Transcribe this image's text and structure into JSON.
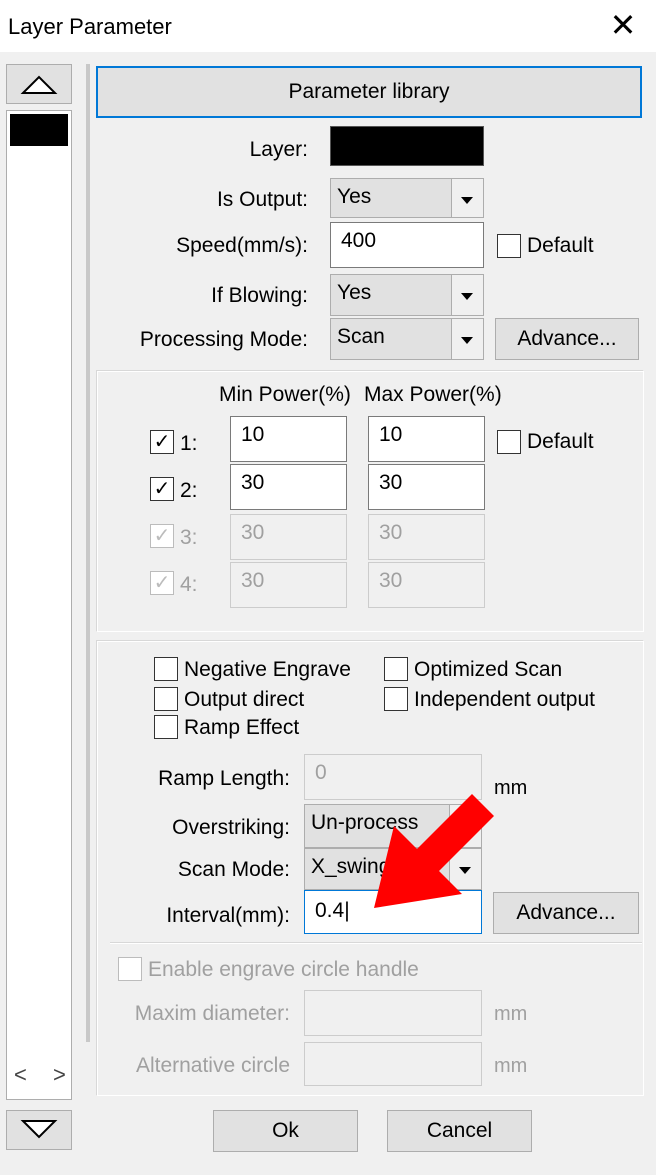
{
  "window": {
    "title": "Layer Parameter",
    "close_glyph": "✕"
  },
  "sidebar": {
    "up_icon": "triangle-up-icon",
    "down_icon": "triangle-down-icon",
    "scroll_arrows": "< >"
  },
  "header": {
    "param_library_label": "Parameter library"
  },
  "layer": {
    "label": "Layer:",
    "color": "#000000"
  },
  "is_output": {
    "label": "Is Output:",
    "value": "Yes"
  },
  "speed": {
    "label": "Speed(mm/s):",
    "value": "400",
    "default_label": "Default",
    "default_checked": false
  },
  "if_blowing": {
    "label": "If Blowing:",
    "value": "Yes"
  },
  "processing_mode": {
    "label": "Processing Mode:",
    "value": "Scan",
    "advance_label": "Advance..."
  },
  "power": {
    "min_header": "Min Power(%)",
    "max_header": "Max Power(%)",
    "default_label": "Default",
    "rows": [
      {
        "label": "1:",
        "checked": true,
        "enabled": true,
        "min": "10",
        "max": "10"
      },
      {
        "label": "2:",
        "checked": true,
        "enabled": true,
        "min": "30",
        "max": "30"
      },
      {
        "label": "3:",
        "checked": true,
        "enabled": false,
        "min": "30",
        "max": "30"
      },
      {
        "label": "4:",
        "checked": true,
        "enabled": false,
        "min": "30",
        "max": "30"
      }
    ]
  },
  "options": {
    "negative_engrave": "Negative Engrave",
    "optimized_scan": "Optimized Scan",
    "output_direct": "Output direct",
    "independent_output": "Independent output",
    "ramp_effect": "Ramp Effect"
  },
  "ramp_length": {
    "label": "Ramp Length:",
    "value": "0",
    "unit": "mm"
  },
  "overstriking": {
    "label": "Overstriking:",
    "value": "Un-process"
  },
  "scan_mode": {
    "label": "Scan Mode:",
    "value": "X_swing"
  },
  "interval": {
    "label": "Interval(mm):",
    "value": "0.4",
    "advance_label": "Advance..."
  },
  "circle": {
    "enable_label": "Enable engrave circle handle",
    "maxim_label": "Maxim diameter:",
    "maxim_unit": "mm",
    "alt_label": "Alternative circle",
    "alt_unit": "mm"
  },
  "footer": {
    "ok_label": "Ok",
    "cancel_label": "Cancel"
  },
  "annotation": {
    "arrow_color": "#ff0000"
  }
}
